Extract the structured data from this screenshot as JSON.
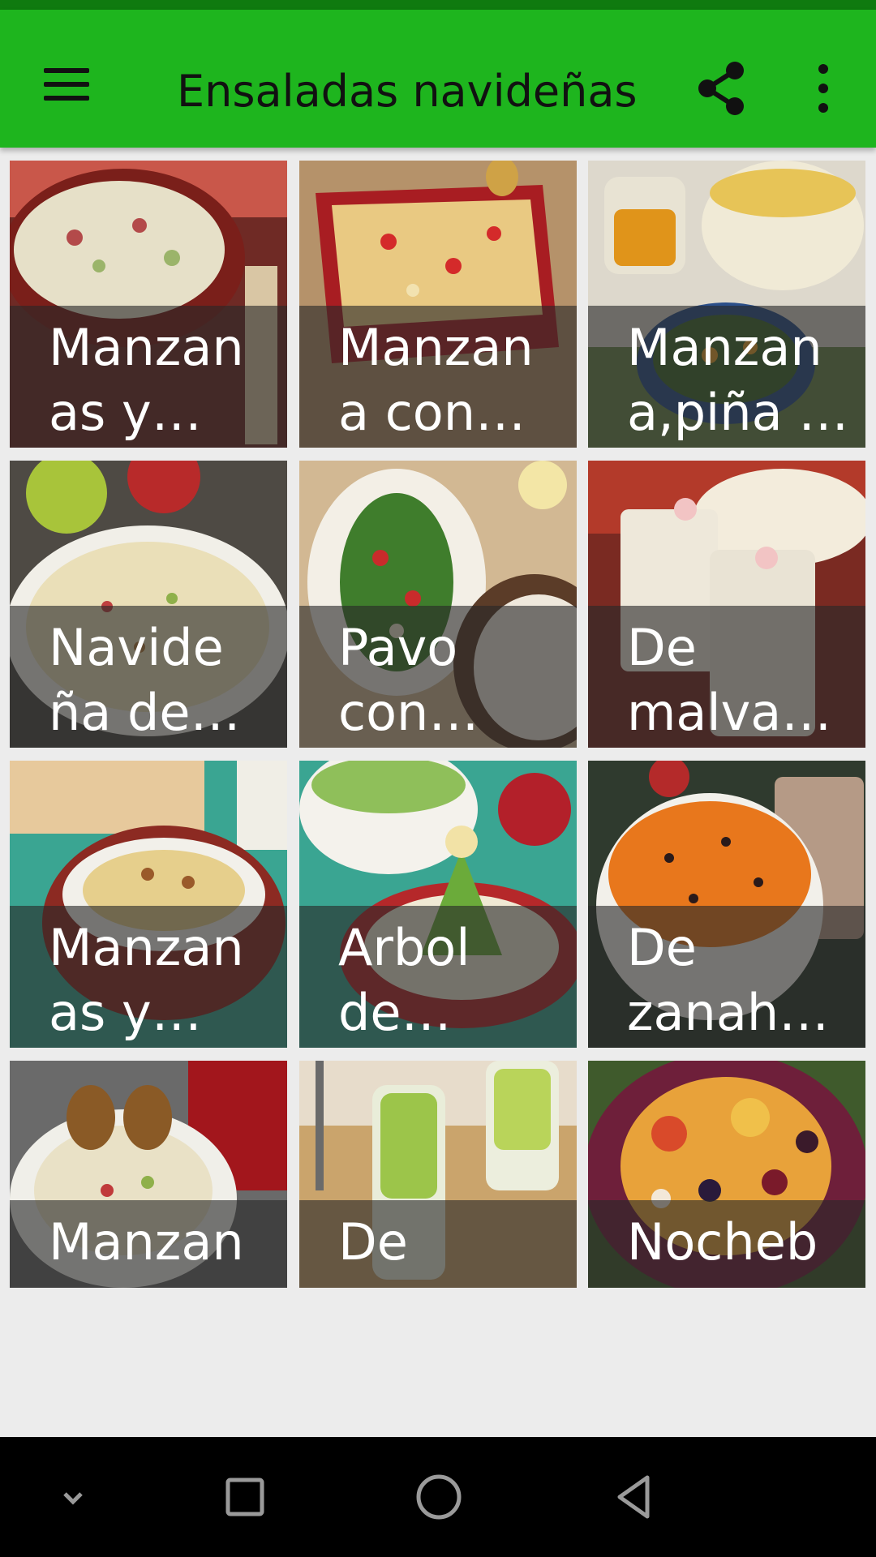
{
  "app_bar": {
    "title": "Ensaladas navideñas",
    "menu_icon": "hamburger-menu-icon",
    "share_icon": "share-icon",
    "more_icon": "more-vert-icon",
    "color": "#1eb51e"
  },
  "recipes": [
    {
      "caption": "Manzan\nas y…"
    },
    {
      "caption": "Manzan\na con…"
    },
    {
      "caption": "Manzan\na,piña …"
    },
    {
      "caption": "Navide\nña de…"
    },
    {
      "caption": "Pavo\ncon…"
    },
    {
      "caption": "De\nmalva…"
    },
    {
      "caption": "Manzan\nas y…"
    },
    {
      "caption": "Arbol\nde…"
    },
    {
      "caption": "De\nzanah…"
    },
    {
      "caption": "Manzan"
    },
    {
      "caption": "De"
    },
    {
      "caption": "Nocheb"
    }
  ],
  "nav_bar": {
    "icons": [
      "chevron-down-icon",
      "recents-square-icon",
      "home-circle-icon",
      "back-triangle-icon"
    ]
  }
}
